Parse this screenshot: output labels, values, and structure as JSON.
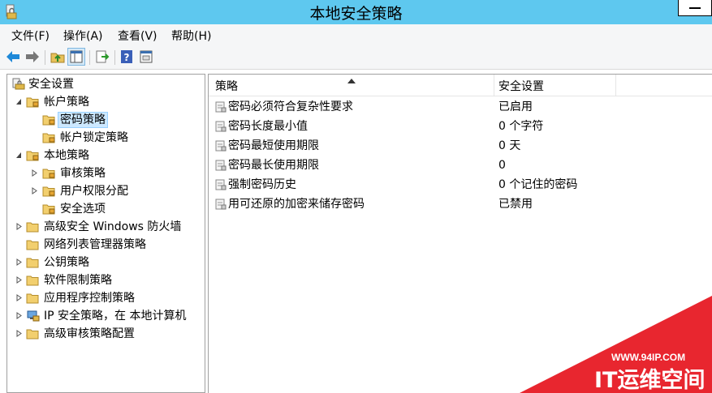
{
  "window": {
    "title": "本地安全策略"
  },
  "menu": [
    {
      "label": "文件(F)"
    },
    {
      "label": "操作(A)"
    },
    {
      "label": "查看(V)"
    },
    {
      "label": "帮助(H)"
    }
  ],
  "toolbar": {
    "icons": [
      "back-arrow-icon",
      "forward-arrow-icon",
      "up-folder-icon",
      "show-tree-icon",
      "export-list-icon",
      "help-icon",
      "properties-icon"
    ]
  },
  "tree": {
    "items": [
      {
        "label": "安全设置"
      },
      {
        "label": "帐户策略"
      },
      {
        "label": "密码策略"
      },
      {
        "label": "帐户锁定策略"
      },
      {
        "label": "本地策略"
      },
      {
        "label": "审核策略"
      },
      {
        "label": "用户权限分配"
      },
      {
        "label": "安全选项"
      },
      {
        "label": "高级安全 Windows 防火墙"
      },
      {
        "label": "网络列表管理器策略"
      },
      {
        "label": "公钥策略"
      },
      {
        "label": "软件限制策略"
      },
      {
        "label": "应用程序控制策略"
      },
      {
        "label": "IP 安全策略，在 本地计算机"
      },
      {
        "label": "高级审核策略配置"
      }
    ]
  },
  "list": {
    "columns": {
      "policy": "策略",
      "setting": "安全设置"
    },
    "rows": [
      {
        "policy": "密码必须符合复杂性要求",
        "setting": "已启用"
      },
      {
        "policy": "密码长度最小值",
        "setting": "0 个字符"
      },
      {
        "policy": "密码最短使用期限",
        "setting": "0 天"
      },
      {
        "policy": "密码最长使用期限",
        "setting": "0"
      },
      {
        "policy": "强制密码历史",
        "setting": "0 个记住的密码"
      },
      {
        "policy": "用可还原的加密来储存密码",
        "setting": "已禁用"
      }
    ]
  },
  "watermark": {
    "url": "WWW.94IP.COM",
    "brand": "IT运维空间",
    "color": "#e8262f"
  }
}
